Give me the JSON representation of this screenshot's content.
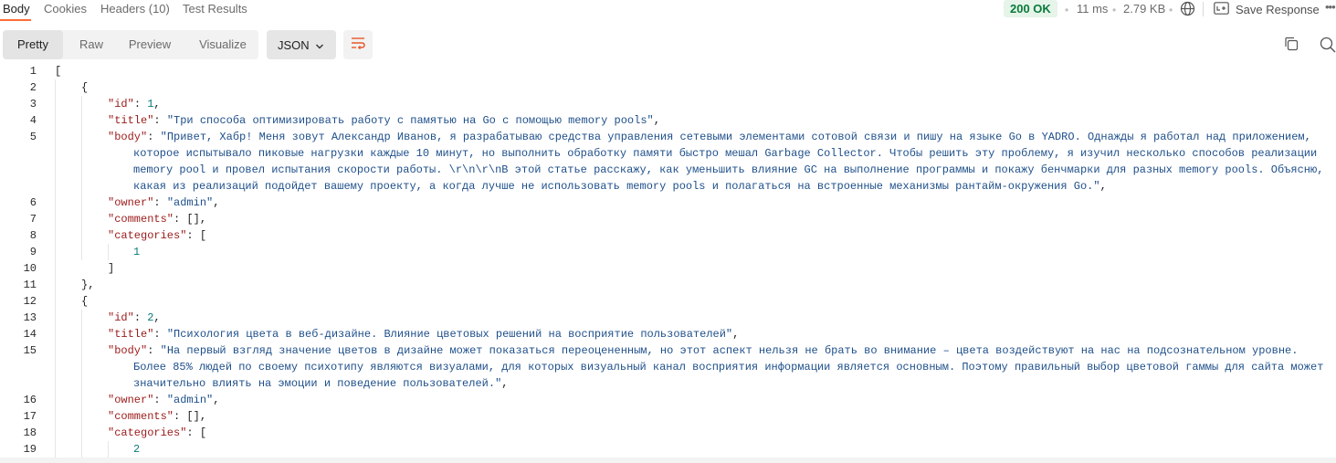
{
  "tabs": {
    "body": "Body",
    "cookies": "Cookies",
    "headers": "Headers (10)",
    "test_results": "Test Results"
  },
  "status": {
    "code": "200 OK",
    "time": "11 ms",
    "size": "2.79 KB",
    "save_response": "Save Response",
    "accent": "#ff6c37",
    "ok_color": "#0b7a3a"
  },
  "toolbar": {
    "pretty": "Pretty",
    "raw": "Raw",
    "preview": "Preview",
    "visualize": "Visualize",
    "format": "JSON"
  },
  "icons": [
    "globe-icon",
    "save-response-icon",
    "more-icon",
    "chevron-down-icon",
    "wrap-lines-icon",
    "copy-icon",
    "search-icon"
  ],
  "code": {
    "line_numbers": [
      "1",
      "2",
      "3",
      "4",
      "5",
      "6",
      "7",
      "8",
      "9",
      "10",
      "11",
      "12",
      "13",
      "14",
      "15",
      "16",
      "17",
      "18",
      "19"
    ],
    "post1": {
      "id_key": "\"id\"",
      "id_val": "1",
      "title_key": "\"title\"",
      "title_val": "\"Три способа оптимизировать работу с памятью на Go с помощью memory pools\"",
      "body_key": "\"body\"",
      "body_lines": [
        "\"Привет, Хабр! Меня зовут Александр Иванов, я разрабатываю средства управления сетевыми элементами сотовой связи и пишу на языке Go в YADRO. Однажды я работал над приложением,",
        "которое испытывало пиковые нагрузки каждые 10 минут, но выполнить обработку памяти быстро мешал Garbage Collector. Чтобы решить эту проблему, я изучил несколько способов реализации",
        "memory pool и провел испытания скорости работы. \\r\\n\\r\\nВ этой статье расскажу, как уменьшить влияние GC на выполнение программы и покажу бенчмарки для разных memory pools. Объясню,",
        "какая из реализаций подойдет вашему проекту, а когда лучше не использовать memory pools и полагаться на встроенные механизмы рантайм-окружения Go.\""
      ],
      "owner_key": "\"owner\"",
      "owner_val": "\"admin\"",
      "comments_key": "\"comments\"",
      "comments_val": "[]",
      "categories_key": "\"categories\"",
      "category_1": "1"
    },
    "post2": {
      "id_key": "\"id\"",
      "id_val": "2",
      "title_key": "\"title\"",
      "title_val": "\"Психология цвета в веб-дизайне. Влияние цветовых решений на восприятие пользователей\"",
      "body_key": "\"body\"",
      "body_lines": [
        "\"На первый взгляд значение цветов в дизайне может показаться переоцененным, но этот аспект нельзя не брать во внимание – цвета воздействуют на нас на подсознательном уровне.",
        "Более 85% людей по своему психотипу являются визуалами, для которых визуальный канал восприятия информации является основным. Поэтому правильный выбор цветовой гаммы для сайта может",
        "значительно влиять на эмоции и поведение пользователей.\""
      ],
      "owner_key": "\"owner\"",
      "owner_val": "\"admin\"",
      "comments_key": "\"comments\"",
      "comments_val": "[]",
      "categories_key": "\"categories\"",
      "category_1": "2"
    }
  }
}
